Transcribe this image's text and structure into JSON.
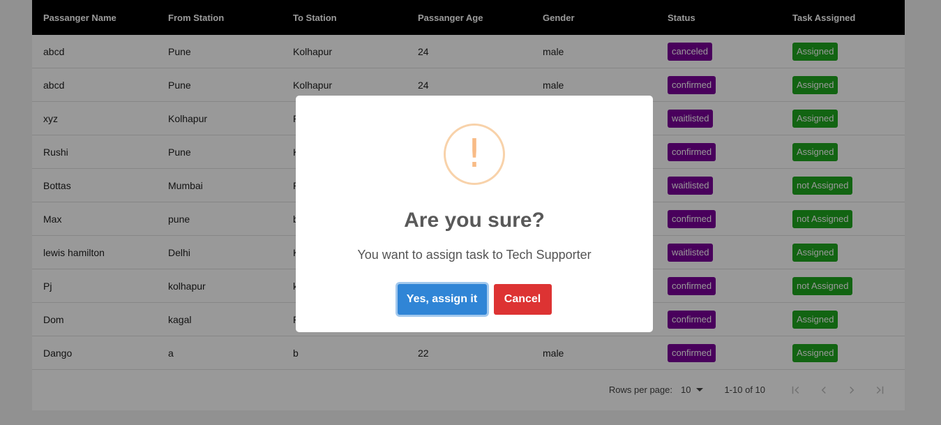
{
  "table": {
    "columns": [
      "Passanger Name",
      "From Station",
      "To Station",
      "Passanger Age",
      "Gender",
      "Status",
      "Task Assigned"
    ],
    "rows": [
      {
        "name": "abcd",
        "from": "Pune",
        "to": "Kolhapur",
        "age": "24",
        "gender": "male",
        "status": "canceled",
        "task": "Assigned"
      },
      {
        "name": "abcd",
        "from": "Pune",
        "to": "Kolhapur",
        "age": "24",
        "gender": "male",
        "status": "confirmed",
        "task": "Assigned"
      },
      {
        "name": "xyz",
        "from": "Kolhapur",
        "to": "P",
        "age": "",
        "gender": "",
        "status": "waitlisted",
        "task": "Assigned"
      },
      {
        "name": "Rushi",
        "from": "Pune",
        "to": "K",
        "age": "",
        "gender": "",
        "status": "confirmed",
        "task": "Assigned"
      },
      {
        "name": "Bottas",
        "from": "Mumbai",
        "to": "P",
        "age": "",
        "gender": "",
        "status": "waitlisted",
        "task": "not Assigned"
      },
      {
        "name": "Max",
        "from": "pune",
        "to": "b",
        "age": "",
        "gender": "",
        "status": "confirmed",
        "task": "not Assigned"
      },
      {
        "name": "lewis hamilton",
        "from": "Delhi",
        "to": "K",
        "age": "",
        "gender": "",
        "status": "waitlisted",
        "task": "Assigned"
      },
      {
        "name": "Pj",
        "from": "kolhapur",
        "to": "k",
        "age": "",
        "gender": "",
        "status": "confirmed",
        "task": "not Assigned"
      },
      {
        "name": "Dom",
        "from": "kagal",
        "to": "P",
        "age": "",
        "gender": "",
        "status": "confirmed",
        "task": "Assigned"
      },
      {
        "name": "Dango",
        "from": "a",
        "to": "b",
        "age": "22",
        "gender": "male",
        "status": "confirmed",
        "task": "Assigned"
      }
    ]
  },
  "pagination": {
    "rows_per_page_label": "Rows per page:",
    "rows_per_page_value": "10",
    "range_text": "1-10 of 10",
    "icons": [
      "first-page-icon",
      "previous-page-icon",
      "next-page-icon",
      "last-page-icon"
    ]
  },
  "dialog": {
    "icon": "exclamation-icon",
    "icon_glyph": "!",
    "title": "Are you sure?",
    "text": "You want to assign task to Tech Supporter",
    "confirm_label": "Yes, assign it",
    "cancel_label": "Cancel"
  },
  "colors": {
    "header_bg": "#000000",
    "status_badge": "#7b0099",
    "task_badge": "#1ea71e",
    "confirm_button": "#3085d6",
    "cancel_button": "#dd3333",
    "warning_icon": "#f8bb86"
  }
}
